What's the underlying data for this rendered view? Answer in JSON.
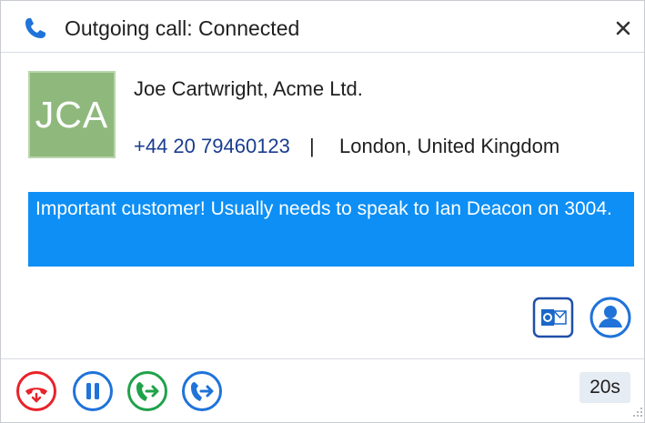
{
  "window": {
    "title": "Outgoing call: Connected",
    "icons": {
      "title": "phone-handset-icon",
      "close": "close-icon"
    }
  },
  "contact": {
    "initials": "JCA",
    "name": "Joe Cartwright, Acme Ltd.",
    "phone": "+44 20 79460123",
    "separator": "|",
    "location": "London, United Kingdom"
  },
  "note": {
    "text": "Important customer! Usually needs to speak to Ian Deacon on 3004."
  },
  "side_actions": [
    {
      "icon": "outlook-icon"
    },
    {
      "icon": "contact-person-icon"
    }
  ],
  "call_controls": [
    {
      "icon": "hang-up-icon",
      "color": "#e8232a"
    },
    {
      "icon": "pause-icon",
      "color": "#1f73d9"
    },
    {
      "icon": "transfer-icon",
      "color": "#1fa24a"
    },
    {
      "icon": "forward-call-icon",
      "color": "#1f73d9"
    }
  ],
  "call_timer": "20s",
  "colors": {
    "note_background": "#0d8ff5",
    "avatar_background": "#8fb97c",
    "phone_text": "#1a3d8f"
  }
}
